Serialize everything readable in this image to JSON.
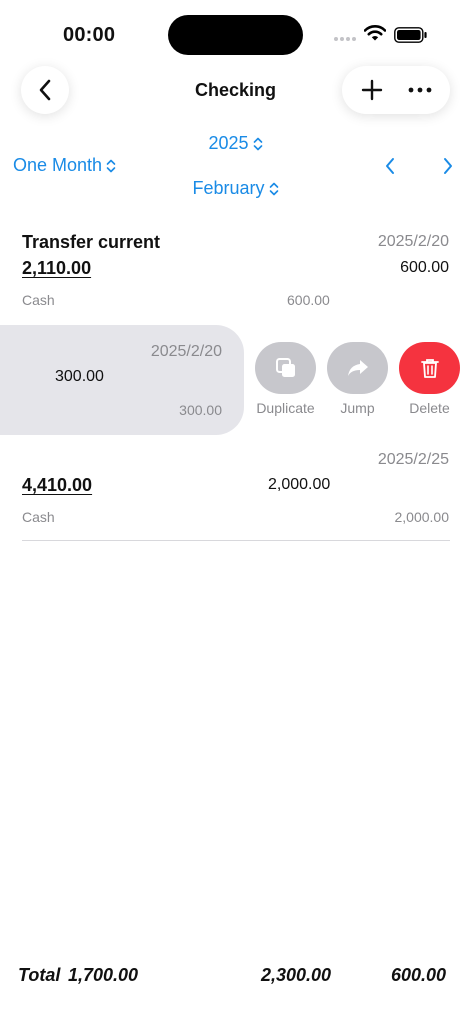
{
  "status": {
    "time": "00:00"
  },
  "header": {
    "title": "Checking"
  },
  "icons": {
    "back": "chevron-left-icon",
    "add": "plus-icon",
    "more": "ellipsis-icon",
    "prev": "chevron-left-icon",
    "next": "chevron-right-icon",
    "updown": "chevron-up-down-icon"
  },
  "filters": {
    "year": "2025",
    "range": "One Month",
    "month": "February"
  },
  "transactions": [
    {
      "title": "Transfer current",
      "date": "2025/2/20",
      "balance": "2,110.00",
      "amount": "600.00",
      "account": "Cash",
      "sub_amount": "600.00"
    },
    {
      "date": "2025/2/20",
      "amount": "300.00",
      "sub_amount": "300.00"
    },
    {
      "date": "2025/2/25",
      "balance": "4,410.00",
      "amount": "2,000.00",
      "account": "Cash",
      "sub_amount": "2,000.00"
    }
  ],
  "swipe_actions": {
    "duplicate": "Duplicate",
    "jump": "Jump",
    "delete": "Delete"
  },
  "totals": {
    "label": "Total",
    "first": "1,700.00",
    "second": "2,300.00",
    "third": "600.00"
  },
  "colors": {
    "accent": "#1a8be6",
    "delete": "#f5333f",
    "action_gray": "#c7c7cc",
    "swipe_bg": "#e5e5ea"
  }
}
